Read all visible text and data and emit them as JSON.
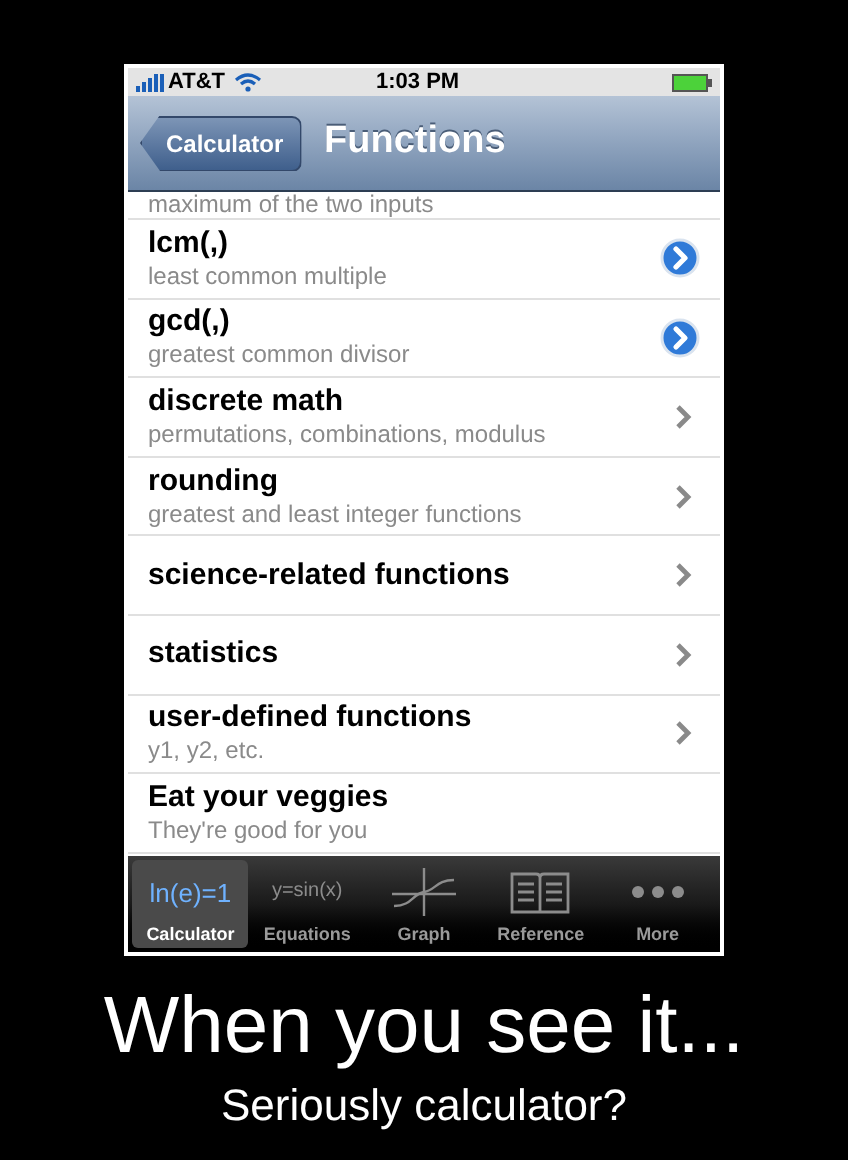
{
  "status_bar": {
    "carrier": "AT&T",
    "time": "1:03 PM"
  },
  "nav_bar": {
    "back_button": "Calculator",
    "title": "Functions"
  },
  "list": {
    "partial_subtitle": "maximum of the two inputs",
    "rows": [
      {
        "title": "lcm(,)",
        "subtitle": "least common multiple",
        "kind": "detail"
      },
      {
        "title": "gcd(,)",
        "subtitle": "greatest common divisor",
        "kind": "detail"
      },
      {
        "title": "discrete math",
        "subtitle": "permutations, combinations, modulus",
        "kind": "chevron"
      },
      {
        "title": "rounding",
        "subtitle": "greatest and least integer functions",
        "kind": "chevron"
      },
      {
        "title": "science-related functions",
        "kind": "chevron"
      },
      {
        "title": "statistics",
        "kind": "chevron"
      },
      {
        "title": "user-defined functions",
        "subtitle": "y1, y2, etc.",
        "kind": "chevron"
      },
      {
        "title": "Eat your veggies",
        "subtitle": "They're good for you",
        "kind": "plain"
      }
    ]
  },
  "tab_bar": [
    {
      "label": "Calculator",
      "kind": "text",
      "icon_text": "ln(e)=1",
      "selected": true
    },
    {
      "label": "Equations",
      "kind": "text",
      "icon_text": "y=sin(x)",
      "selected": false
    },
    {
      "label": "Graph",
      "kind": "graph",
      "selected": false
    },
    {
      "label": "Reference",
      "kind": "book",
      "selected": false
    },
    {
      "label": "More",
      "kind": "dots",
      "selected": false
    }
  ],
  "caption": {
    "headline": "When you see it...",
    "subline": "Seriously calculator?"
  }
}
